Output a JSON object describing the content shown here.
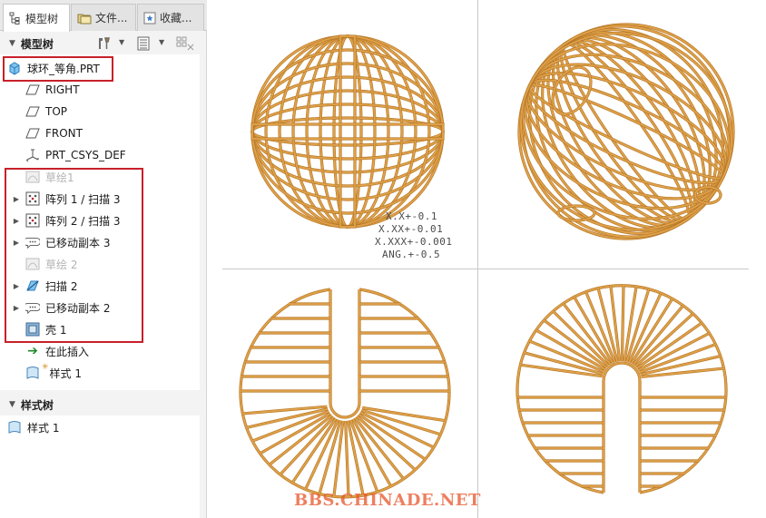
{
  "tabs": [
    {
      "label": "模型树",
      "icon": "model-tree-icon"
    },
    {
      "label": "文件...",
      "icon": "folder-icon"
    },
    {
      "label": "收藏...",
      "icon": "favorites-icon"
    }
  ],
  "model_tree": {
    "header": "模型树",
    "root": "球环_等角.PRT",
    "items": [
      {
        "label": "RIGHT",
        "icon": "datum-plane-icon",
        "expandable": false,
        "dim": false
      },
      {
        "label": "TOP",
        "icon": "datum-plane-icon",
        "expandable": false,
        "dim": false
      },
      {
        "label": "FRONT",
        "icon": "datum-plane-icon",
        "expandable": false,
        "dim": false
      },
      {
        "label": "PRT_CSYS_DEF",
        "icon": "coordinate-system-icon",
        "expandable": false,
        "dim": false
      },
      {
        "label": "草绘1",
        "icon": "sketch-icon",
        "expandable": false,
        "dim": true
      },
      {
        "label": "阵列 1 / 扫描 3",
        "icon": "pattern-icon",
        "expandable": true,
        "dim": false
      },
      {
        "label": "阵列 2 / 扫描 3",
        "icon": "pattern-icon",
        "expandable": true,
        "dim": false
      },
      {
        "label": "已移动副本 3",
        "icon": "moved-copy-icon",
        "expandable": true,
        "dim": false
      },
      {
        "label": "草绘 2",
        "icon": "sketch-icon",
        "expandable": false,
        "dim": true
      },
      {
        "label": "扫描 2",
        "icon": "sweep-icon",
        "expandable": true,
        "dim": false
      },
      {
        "label": "已移动副本 2",
        "icon": "moved-copy-icon",
        "expandable": true,
        "dim": false
      },
      {
        "label": "壳 1",
        "icon": "shell-icon",
        "expandable": false,
        "dim": false
      },
      {
        "label": "在此插入",
        "icon": "insert-here-icon",
        "expandable": false,
        "dim": false
      },
      {
        "label": "样式 1",
        "icon": "style-icon",
        "expandable": false,
        "dim": false
      }
    ]
  },
  "style_tree": {
    "header": "样式树",
    "items": [
      {
        "label": "样式 1",
        "icon": "style-icon"
      }
    ]
  },
  "tolerance": [
    "X.X+-0.1",
    "X.XX+-0.01",
    "X.XXX+-0.001",
    "ANG.+-0.5"
  ],
  "watermark": "BBS.CHINADE.NET",
  "colors": {
    "wire": "#e0a24a",
    "wire_dark": "#b87a2a",
    "highlight": "#c8202a"
  }
}
